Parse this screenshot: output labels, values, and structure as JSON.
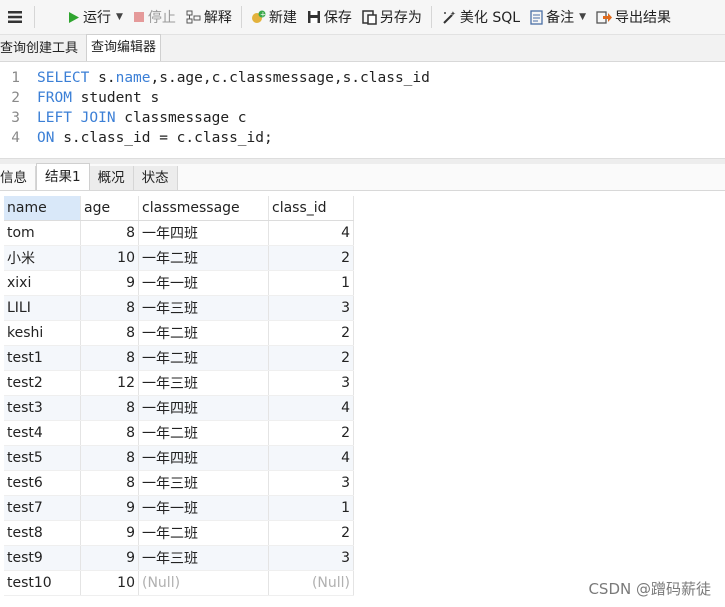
{
  "toolbar": {
    "run": "运行",
    "stop": "停止",
    "explain": "解释",
    "new": "新建",
    "save": "保存",
    "save_as": "另存为",
    "beautify": "美化 SQL",
    "notes": "备注",
    "export": "导出结果"
  },
  "tabs": {
    "query_builder": "查询创建工具",
    "query_editor": "查询编辑器"
  },
  "editor": {
    "line_numbers": [
      "1",
      "2",
      "3",
      "4"
    ],
    "l1": {
      "kw": "SELECT",
      "rest_a": " s.",
      "col": "name",
      "rest_b": ",s.age,c.classmessage,s.class_id"
    },
    "l2": {
      "kw": "FROM",
      "rest": " student s"
    },
    "l3": {
      "kw": "LEFT JOIN",
      "rest": " classmessage c"
    },
    "l4": {
      "kw": "ON",
      "rest": " s.class_id = c.class_id;"
    }
  },
  "result_tabs": {
    "info": "信息",
    "result1": "结果1",
    "profile": "概况",
    "status": "状态"
  },
  "grid": {
    "columns": [
      "name",
      "age",
      "classmessage",
      "class_id"
    ],
    "rows": [
      [
        "tom",
        "8",
        "一年四班",
        "4"
      ],
      [
        "小米",
        "10",
        "一年二班",
        "2"
      ],
      [
        "xixi",
        "9",
        "一年一班",
        "1"
      ],
      [
        "LILI",
        "8",
        "一年三班",
        "3"
      ],
      [
        "keshi",
        "8",
        "一年二班",
        "2"
      ],
      [
        "test1",
        "8",
        "一年二班",
        "2"
      ],
      [
        "test2",
        "12",
        "一年三班",
        "3"
      ],
      [
        "test3",
        "8",
        "一年四班",
        "4"
      ],
      [
        "test4",
        "8",
        "一年二班",
        "2"
      ],
      [
        "test5",
        "8",
        "一年四班",
        "4"
      ],
      [
        "test6",
        "8",
        "一年三班",
        "3"
      ],
      [
        "test7",
        "9",
        "一年一班",
        "1"
      ],
      [
        "test8",
        "9",
        "一年二班",
        "2"
      ],
      [
        "test9",
        "9",
        "一年三班",
        "3"
      ],
      [
        "test10",
        "10",
        "(Null)",
        "(Null)"
      ]
    ]
  },
  "watermark": "CSDN @蹭码薪徒",
  "colors": {
    "keyword": "#3b7fd6",
    "run_green": "#2fa52f",
    "selected_header": "#d9e8f9"
  }
}
